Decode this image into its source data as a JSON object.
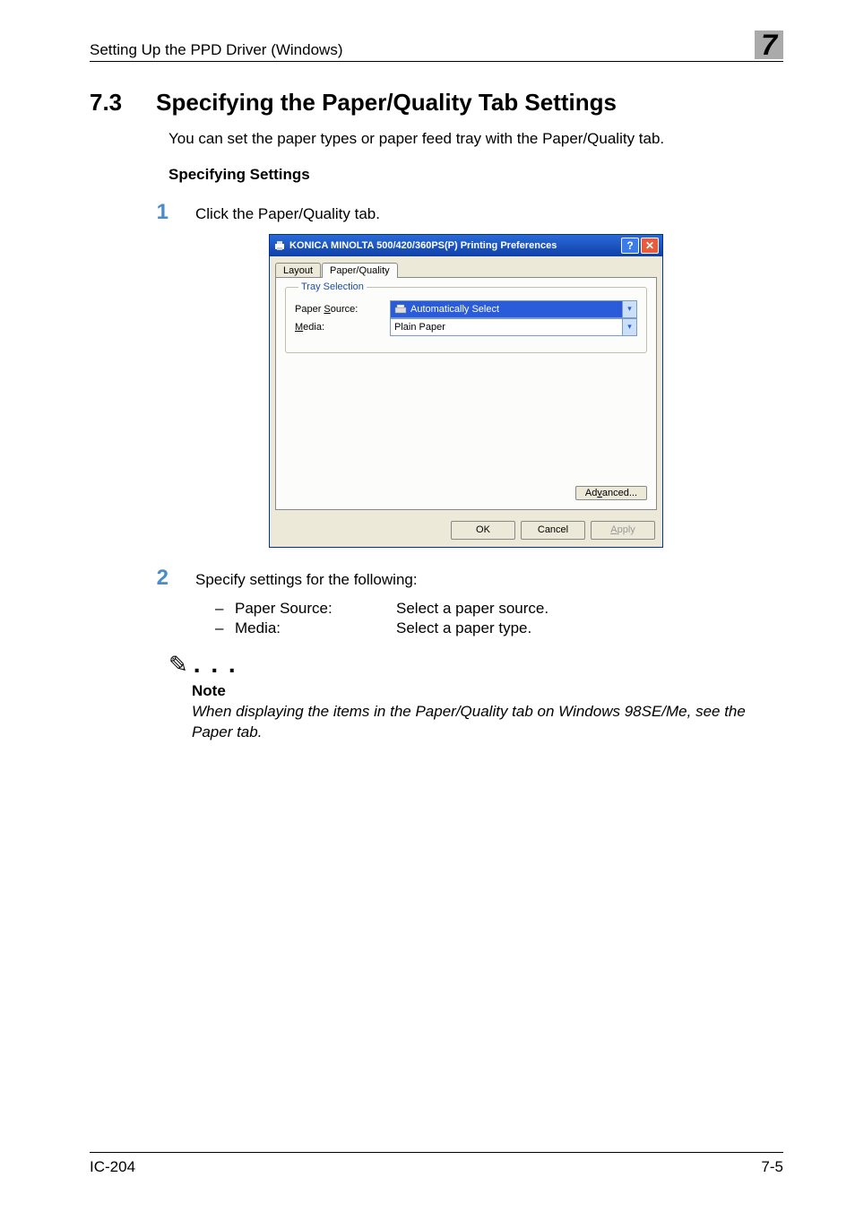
{
  "header": {
    "running_title": "Setting Up the PPD Driver (Windows)",
    "chapter_number": "7"
  },
  "section": {
    "number": "7.3",
    "title": "Specifying the Paper/Quality Tab Settings",
    "intro": "You can set the paper types or paper feed tray with the Paper/Quality tab.",
    "subheading": "Specifying Settings"
  },
  "steps": {
    "s1_num": "1",
    "s1_text": "Click the Paper/Quality tab.",
    "s2_num": "2",
    "s2_text": "Specify settings for the following:"
  },
  "bullets": {
    "b1_label": "Paper Source:",
    "b1_desc": "Select a paper source.",
    "b2_label": "Media:",
    "b2_desc": "Select a paper type.",
    "dash": "–"
  },
  "note": {
    "label": "Note",
    "text": "When displaying the items in the Paper/Quality tab on Windows 98SE/Me, see the Paper tab."
  },
  "dialog": {
    "title": "KONICA MINOLTA 500/420/360PS(P) Printing Preferences",
    "tabs": {
      "layout": "Layout",
      "paper_quality": "Paper/Quality"
    },
    "fieldset_legend": "Tray Selection",
    "paper_source_label_pre": "Paper ",
    "paper_source_label_u": "S",
    "paper_source_label_post": "ource:",
    "paper_source_value": "Automatically Select",
    "media_label_u": "M",
    "media_label_post": "edia:",
    "media_value": "Plain Paper",
    "advanced_pre": "Ad",
    "advanced_u": "v",
    "advanced_post": "anced...",
    "ok": "OK",
    "cancel": "Cancel",
    "apply_u": "A",
    "apply_post": "pply",
    "help_glyph": "?",
    "close_glyph": "✕",
    "arrow_glyph": "▾"
  },
  "footer": {
    "left": "IC-204",
    "right": "7-5"
  }
}
